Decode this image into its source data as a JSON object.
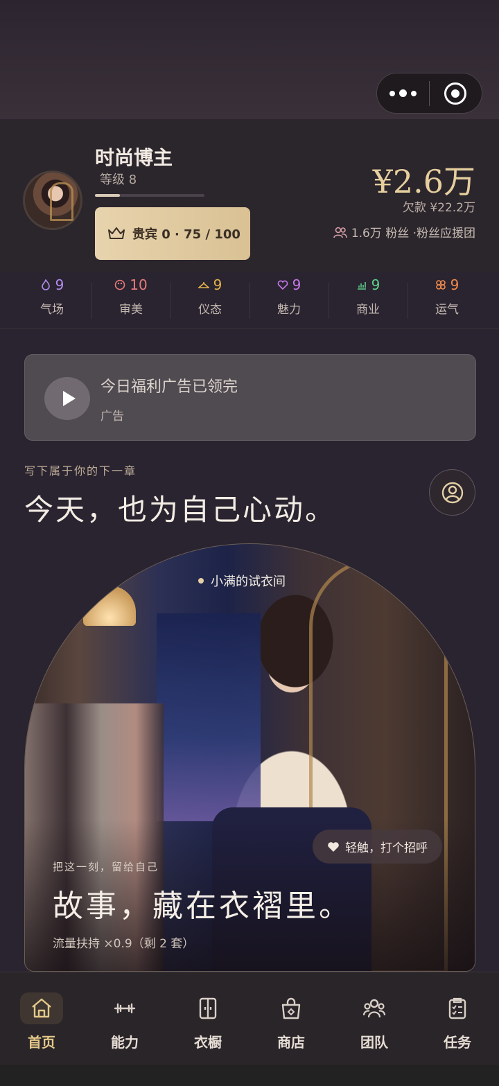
{
  "capsule": {
    "more_icon": "more-dots-icon",
    "close_icon": "target-close-icon"
  },
  "profile": {
    "name": "时尚博主",
    "level": "等级 8",
    "level_progress": 0.23,
    "vip_label": "贵宾 0 · 75 / 100",
    "money": "¥2.6万",
    "debt": "欠款 ¥22.2万",
    "fans": "1.6万 粉丝 ·粉丝应援团"
  },
  "stats": [
    {
      "value": "9",
      "label": "气场",
      "color": "#b28cf0",
      "icon": "flame-icon"
    },
    {
      "value": "10",
      "label": "审美",
      "color": "#e87a7a",
      "icon": "palette-icon"
    },
    {
      "value": "9",
      "label": "仪态",
      "color": "#e2b24a",
      "icon": "hanger-icon"
    },
    {
      "value": "9",
      "label": "魅力",
      "color": "#c678e8",
      "icon": "heart-icon"
    },
    {
      "value": "9",
      "label": "商业",
      "color": "#5ccf8a",
      "icon": "chart-icon"
    },
    {
      "value": "9",
      "label": "运气",
      "color": "#f08a4a",
      "icon": "clover-icon"
    }
  ],
  "ad": {
    "title": "今日福利广告已领完",
    "tag": "广告"
  },
  "chapter": {
    "subtitle": "写下属于你的下一章",
    "headline": "今天，也为自己心动。"
  },
  "scene": {
    "caption": "小满的试衣间",
    "greet": "轻触，打个招呼",
    "keep": "把这一刻，留给自己",
    "story": "故事，藏在衣褶里。",
    "flow": "流量扶持 ×0.9（剩 2 套）"
  },
  "tabs": [
    {
      "label": "首页",
      "icon": "home-icon",
      "active": true
    },
    {
      "label": "能力",
      "icon": "dumbbell-icon"
    },
    {
      "label": "衣橱",
      "icon": "wardrobe-icon"
    },
    {
      "label": "商店",
      "icon": "shopping-bag-icon"
    },
    {
      "label": "团队",
      "icon": "team-icon"
    },
    {
      "label": "任务",
      "icon": "task-list-icon"
    }
  ],
  "colors": {
    "accent": "#e5c98a",
    "vip_bg": "#e0cba3",
    "background": "#2a2430"
  }
}
